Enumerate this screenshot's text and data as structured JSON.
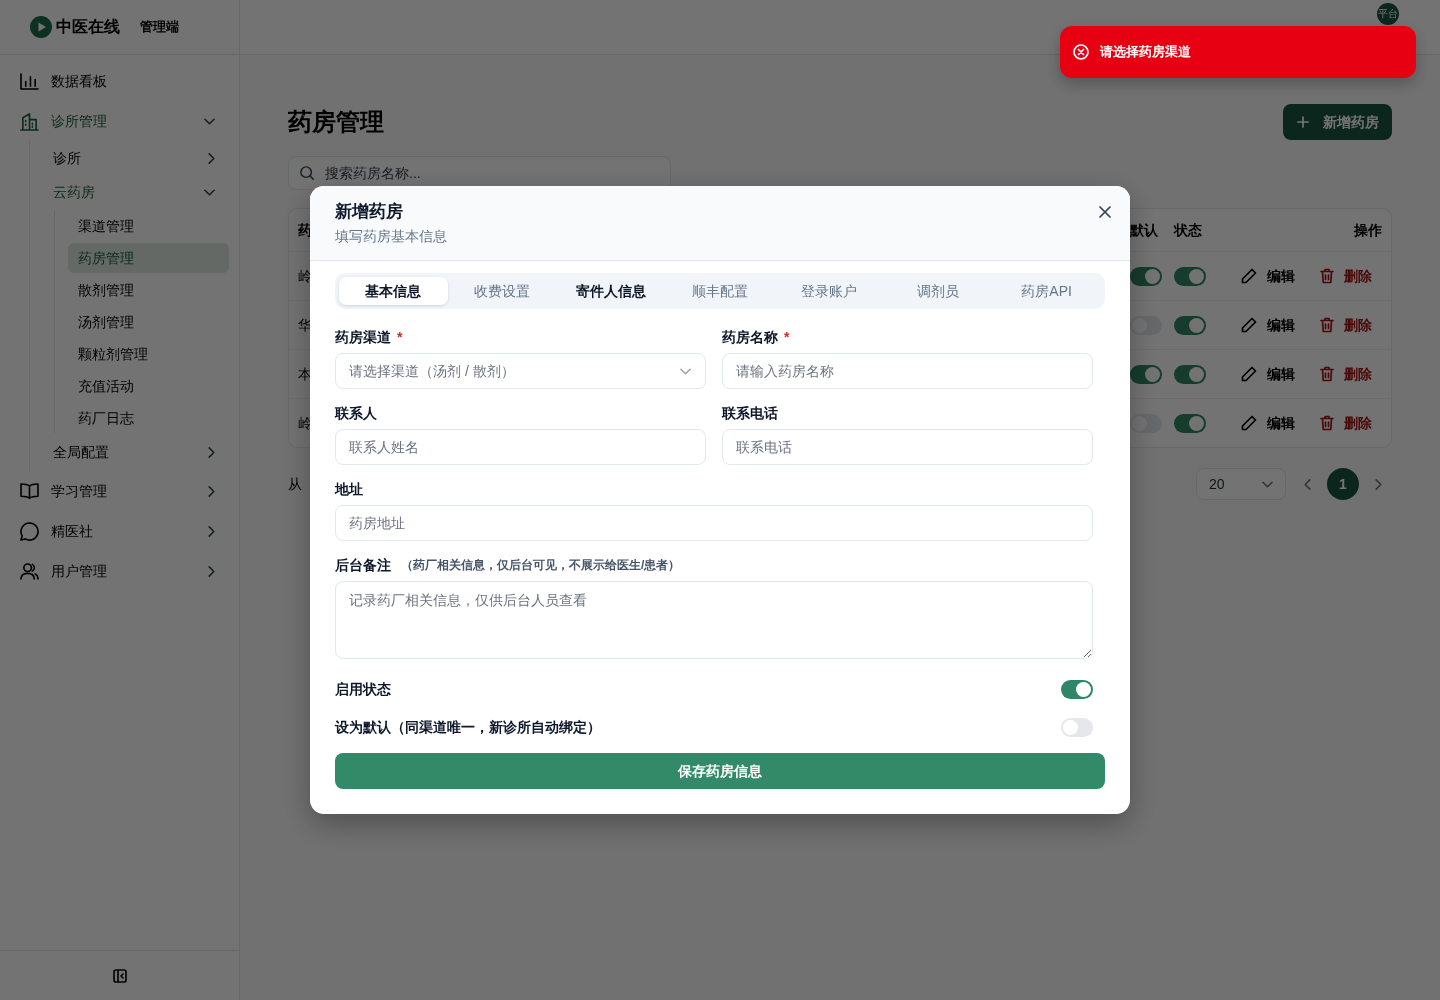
{
  "app": {
    "logo": "中医在线",
    "area": "管理端",
    "avatar": "平台"
  },
  "sidebar": {
    "items": [
      {
        "label": "数据看板",
        "selected": false
      },
      {
        "label": "诊所管理",
        "selected": false,
        "expanded": true,
        "children": [
          {
            "label": "诊所",
            "selected": false,
            "expanded": false
          },
          {
            "label": "云药房",
            "selected": false,
            "expanded": true,
            "children": [
              {
                "label": "渠道管理",
                "selected": false
              },
              {
                "label": "药房管理",
                "selected": true
              },
              {
                "label": "散剂管理",
                "selected": false
              },
              {
                "label": "汤剂管理",
                "selected": false
              },
              {
                "label": "颗粒剂管理",
                "selected": false
              },
              {
                "label": "充值活动",
                "selected": false
              },
              {
                "label": "药厂日志",
                "selected": false
              }
            ]
          },
          {
            "label": "全局配置",
            "selected": false,
            "expanded": false
          }
        ]
      },
      {
        "label": "学习管理",
        "selected": false,
        "expanded": false
      },
      {
        "label": "精医社",
        "selected": false,
        "expanded": false
      },
      {
        "label": "用户管理",
        "selected": false,
        "expanded": false
      }
    ]
  },
  "page": {
    "title": "药房管理",
    "add_button": "新增药房",
    "search": {
      "placeholder": "搜索药房名称..."
    },
    "table": {
      "columns": [
        "药",
        "默认",
        "状态",
        "操作"
      ],
      "rows": [
        {
          "name": "岭",
          "is_default": true,
          "enabled": true,
          "edit": "编辑",
          "delete": "删除"
        },
        {
          "name": "华",
          "is_default": false,
          "enabled": true,
          "edit": "编辑",
          "delete": "删除"
        },
        {
          "name": "本",
          "is_default": true,
          "enabled": true,
          "edit": "编辑",
          "delete": "删除"
        },
        {
          "name": "岭",
          "is_default": false,
          "enabled": true,
          "edit": "编辑",
          "delete": "删除"
        }
      ]
    },
    "pagination": {
      "summary": "从",
      "page_size": "20",
      "pages": [
        {
          "label": "1",
          "selected": true
        }
      ]
    }
  },
  "modal": {
    "title": "新增药房",
    "subtitle": "填写药房基本信息",
    "tabs": [
      {
        "label": "基本信息",
        "selected": true,
        "hovered": false
      },
      {
        "label": "收费设置",
        "selected": false,
        "hovered": false
      },
      {
        "label": "寄件人信息",
        "selected": false,
        "hovered": true
      },
      {
        "label": "顺丰配置",
        "selected": false,
        "hovered": false
      },
      {
        "label": "登录账户",
        "selected": false,
        "hovered": false
      },
      {
        "label": "调剂员",
        "selected": false,
        "hovered": false
      },
      {
        "label": "药房API",
        "selected": false,
        "hovered": false
      }
    ],
    "form": {
      "rows": [
        [
          {
            "kind": "select",
            "label": "药房渠道",
            "required_mark": "*",
            "placeholder": "请选择渠道（汤剂 / 散剂）"
          },
          {
            "kind": "text",
            "label": "药房名称",
            "required_mark": "*",
            "placeholder": "请输入药房名称"
          }
        ],
        [
          {
            "kind": "text",
            "label": "联系人",
            "placeholder": "联系人姓名"
          },
          {
            "kind": "text",
            "label": "联系电话",
            "placeholder": "联系电话"
          }
        ],
        [
          {
            "kind": "text",
            "label": "地址",
            "placeholder": "药房地址"
          }
        ],
        [
          {
            "kind": "textarea",
            "label": "后台备注",
            "hint": "（药厂相关信息，仅后台可见，不展示给医生/患者）",
            "placeholder": "记录药厂相关信息，仅供后台人员查看"
          }
        ]
      ],
      "switches": [
        {
          "label": "启用状态",
          "on": true
        },
        {
          "label": "设为默认（同渠道唯一，新诊所自动绑定）",
          "on": false
        }
      ]
    },
    "submit": "保存药房信息"
  },
  "toast": {
    "kind": "error",
    "message": "请选择药房渠道"
  }
}
